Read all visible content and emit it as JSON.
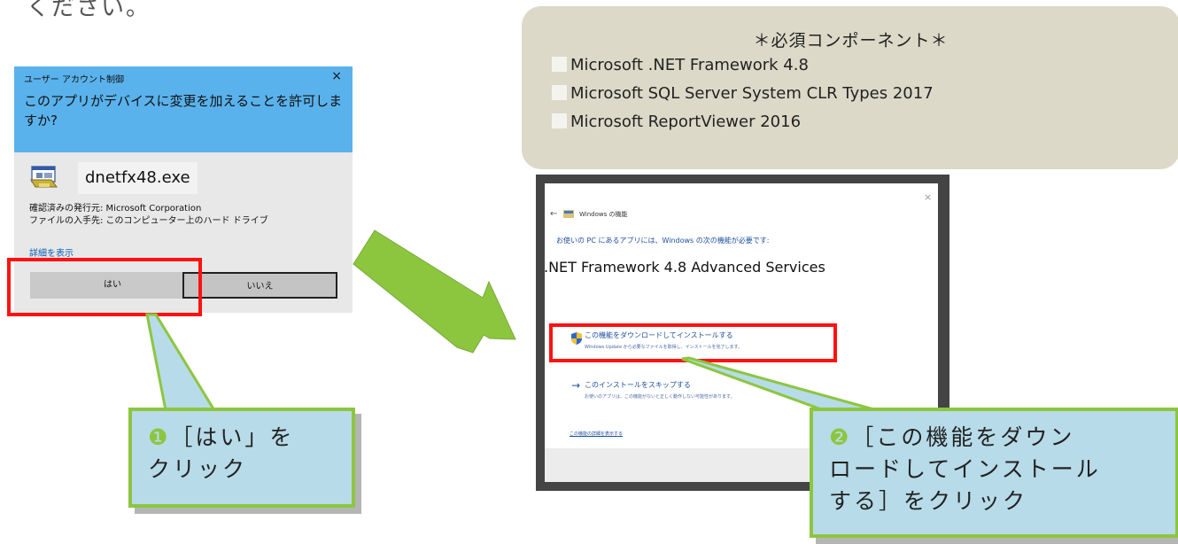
{
  "page": {
    "top_text": "ください。"
  },
  "uac_dialog": {
    "caption": "ユーザー アカウント制御",
    "close_glyph": "×",
    "question": "このアプリがデバイスに変更を加えることを許可しますか?",
    "app_name": "dnetfx48.exe",
    "publisher_line": "確認済みの発行元: Microsoft Corporation",
    "origin_line": "ファイルの入手先: このコンピューター上のハード ドライブ",
    "details_link": "詳細を表示",
    "yes_label": "はい",
    "no_label": "いいえ",
    "header_color": "#5ab2ec"
  },
  "required_components": {
    "title": "＊必須コンポーネント＊",
    "items": [
      "Microsoft .NET Framework 4.8",
      "Microsoft SQL Server System CLR Types 2017",
      "Microsoft ReportViewer 2016"
    ]
  },
  "windows_features_dialog": {
    "close_glyph": "×",
    "back_glyph": "←",
    "title": "Windows の機能",
    "description": "お使いの PC にあるアプリには、Windows の次の機能が必要です:",
    "feature_name": ".NET Framework 4.8 Advanced Services",
    "option_download": "この機能をダウンロードしてインストールする",
    "option_download_sub": "Windows Update から必要なファイルを取得し、インストールを完了します。",
    "option_skip_arrow": "→",
    "option_skip": "このインストールをスキップする",
    "option_skip_sub": "お使いのアプリは、この機能がないと正しく動作しない可能性があります。",
    "details_link": "この機能の詳細を表示する"
  },
  "callouts": [
    {
      "number": "❶",
      "text_line1": "［はい」を",
      "text_line2": "クリック"
    },
    {
      "number": "❷",
      "text_line1": "［この機能をダウン",
      "text_line2": "ロードしてインストール",
      "text_line3": "する］をクリック"
    }
  ],
  "colors": {
    "highlight_red": "#ff1111",
    "callout_fill": "#b7dbe8",
    "accent_green": "#8cc63f"
  }
}
